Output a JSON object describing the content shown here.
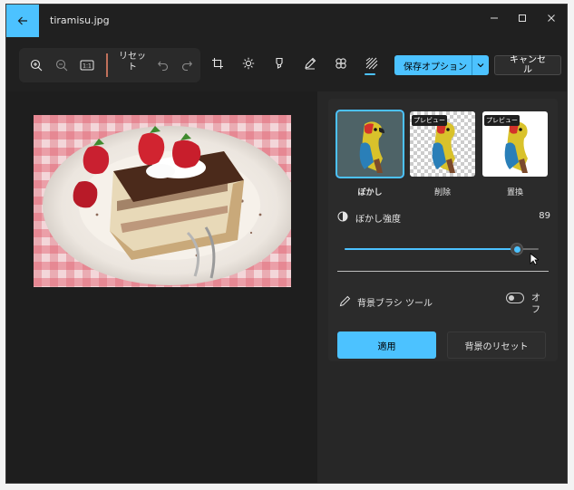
{
  "window": {
    "title": "tiramisu.jpg",
    "accent": "#4cc2ff"
  },
  "toolbar": {
    "reset_label": "リセット",
    "save_label": "保存オプション",
    "cancel_label": "キャンセル",
    "zoom_fit_label": "1:1"
  },
  "panel": {
    "options": [
      {
        "label": "ぼかし",
        "badge": ""
      },
      {
        "label": "削除",
        "badge": "プレビュー"
      },
      {
        "label": "置換",
        "badge": "プレビュー"
      }
    ],
    "blur": {
      "label": "ぼかし強度",
      "value": "89",
      "fraction": 0.89
    },
    "brush": {
      "label": "背景ブラシ ツール",
      "toggle_state": "オフ"
    },
    "apply_label": "適用",
    "reset_background_label": "背景のリセット"
  }
}
